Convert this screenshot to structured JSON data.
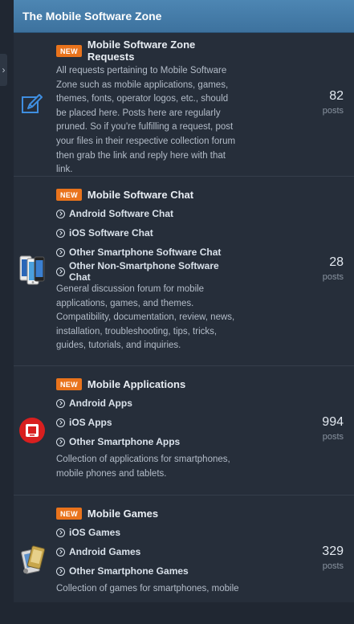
{
  "header": {
    "title": "The Mobile Software Zone"
  },
  "badge_label": "NEW",
  "forums": [
    {
      "title": "Mobile Software Zone Requests",
      "icon": "edit-icon",
      "subforums": [],
      "description": "All requests pertaining to Mobile Software Zone such as mobile applications, games, themes, fonts, operator logos, etc., should be placed here. Posts here are regularly pruned. So if you're fulfilling a request, post your files in their respective collection forum then grab the link and reply here with that link.",
      "count": "82",
      "count_label": "posts"
    },
    {
      "title": "Mobile Software Chat",
      "icon": "smartphones-icon",
      "subforums": [
        "Android Software Chat",
        "iOS Software Chat",
        "Other Smartphone Software Chat",
        "Other Non-Smartphone Software Chat"
      ],
      "description": "General discussion forum for mobile applications, games, and themes. Compatibility, documentation, review, news, installation, troubleshooting, tips, tricks, guides, tutorials, and inquiries.",
      "count": "28",
      "count_label": "posts"
    },
    {
      "title": "Mobile Applications",
      "icon": "mobile-app-icon",
      "subforums": [
        "Android Apps",
        "iOS Apps",
        "Other Smartphone Apps"
      ],
      "description": "Collection of applications for smartphones, mobile phones and tablets.",
      "count": "994",
      "count_label": "posts"
    },
    {
      "title": "Mobile Games",
      "icon": "mobile-games-icon",
      "subforums": [
        "iOS Games",
        "Android Games",
        "Other Smartphone Games"
      ],
      "description": "Collection of games for smartphones, mobile",
      "count": "329",
      "count_label": "posts"
    }
  ]
}
